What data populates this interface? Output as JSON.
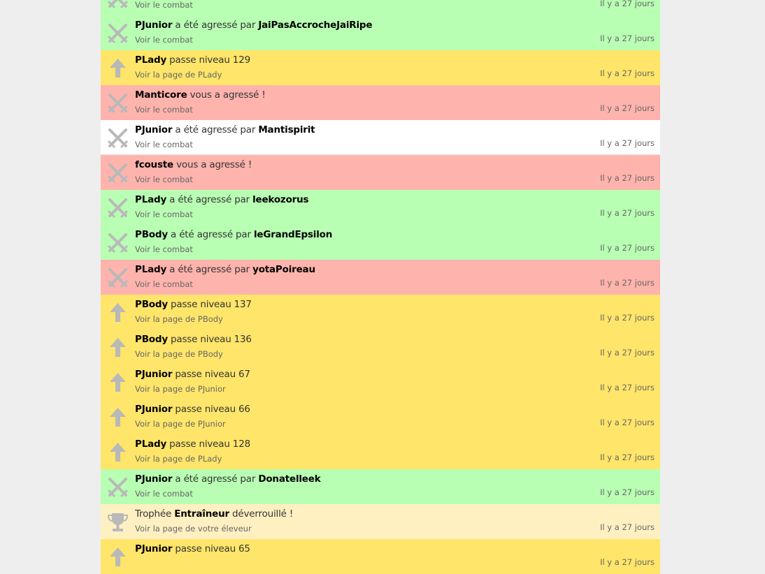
{
  "date_text": "Il y a 27 jours",
  "rows": [
    {
      "type": "fight-win",
      "icon": "crossed-swords-icon",
      "a": "",
      "mid": "",
      "b": "",
      "tail": "",
      "link": "Voir le combat"
    },
    {
      "type": "fight-win",
      "icon": "crossed-swords-icon",
      "a": "PJunior",
      "mid": "a été agressé par",
      "b": "JaiPasAccrocheJaiRipe",
      "tail": "",
      "link": "Voir le combat"
    },
    {
      "type": "levelup",
      "icon": "up-arrow-icon",
      "a": "PLady",
      "mid": "passe niveau 129",
      "b": "",
      "tail": "",
      "link": "Voir la page de PLady"
    },
    {
      "type": "fight-lose",
      "icon": "crossed-swords-icon",
      "a": "Manticore",
      "mid": "vous a agressé !",
      "b": "",
      "tail": "",
      "link": "Voir le combat"
    },
    {
      "type": "fight-neutral",
      "icon": "crossed-swords-icon",
      "a": "PJunior",
      "mid": "a été agressé par",
      "b": "Mantispirit",
      "tail": "",
      "link": "Voir le combat"
    },
    {
      "type": "fight-lose",
      "icon": "crossed-swords-icon",
      "a": "fcouste",
      "mid": "vous a agressé !",
      "b": "",
      "tail": "",
      "link": "Voir le combat"
    },
    {
      "type": "fight-win",
      "icon": "crossed-swords-icon",
      "a": "PLady",
      "mid": "a été agressé par",
      "b": "leekozorus",
      "tail": "",
      "link": "Voir le combat"
    },
    {
      "type": "fight-win",
      "icon": "crossed-swords-icon",
      "a": "PBody",
      "mid": "a été agressé par",
      "b": "leGrandEpsilon",
      "tail": "",
      "link": "Voir le combat"
    },
    {
      "type": "fight-lose",
      "icon": "crossed-swords-icon",
      "a": "PLady",
      "mid": "a été agressé par",
      "b": "yotaPoireau",
      "tail": "",
      "link": "Voir le combat"
    },
    {
      "type": "levelup",
      "icon": "up-arrow-icon",
      "a": "PBody",
      "mid": "passe niveau 137",
      "b": "",
      "tail": "",
      "link": "Voir la page de PBody"
    },
    {
      "type": "levelup",
      "icon": "up-arrow-icon",
      "a": "PBody",
      "mid": "passe niveau 136",
      "b": "",
      "tail": "",
      "link": "Voir la page de PBody"
    },
    {
      "type": "levelup",
      "icon": "up-arrow-icon",
      "a": "PJunior",
      "mid": "passe niveau 67",
      "b": "",
      "tail": "",
      "link": "Voir la page de PJunior"
    },
    {
      "type": "levelup",
      "icon": "up-arrow-icon",
      "a": "PJunior",
      "mid": "passe niveau 66",
      "b": "",
      "tail": "",
      "link": "Voir la page de PJunior"
    },
    {
      "type": "levelup",
      "icon": "up-arrow-icon",
      "a": "PLady",
      "mid": "passe niveau 128",
      "b": "",
      "tail": "",
      "link": "Voir la page de PLady"
    },
    {
      "type": "fight-win",
      "icon": "crossed-swords-icon",
      "a": "PJunior",
      "mid": "a été agressé par",
      "b": "Donatelleek",
      "tail": "",
      "link": "Voir le combat"
    },
    {
      "type": "trophy",
      "icon": "trophy-icon",
      "pre": "Trophée",
      "a": "Entraîneur",
      "mid": "déverrouillé !",
      "b": "",
      "tail": "",
      "link": "Voir la page de votre éleveur"
    },
    {
      "type": "levelup",
      "icon": "up-arrow-icon",
      "a": "PJunior",
      "mid": "passe niveau 65",
      "b": "",
      "tail": "",
      "link": ""
    }
  ]
}
